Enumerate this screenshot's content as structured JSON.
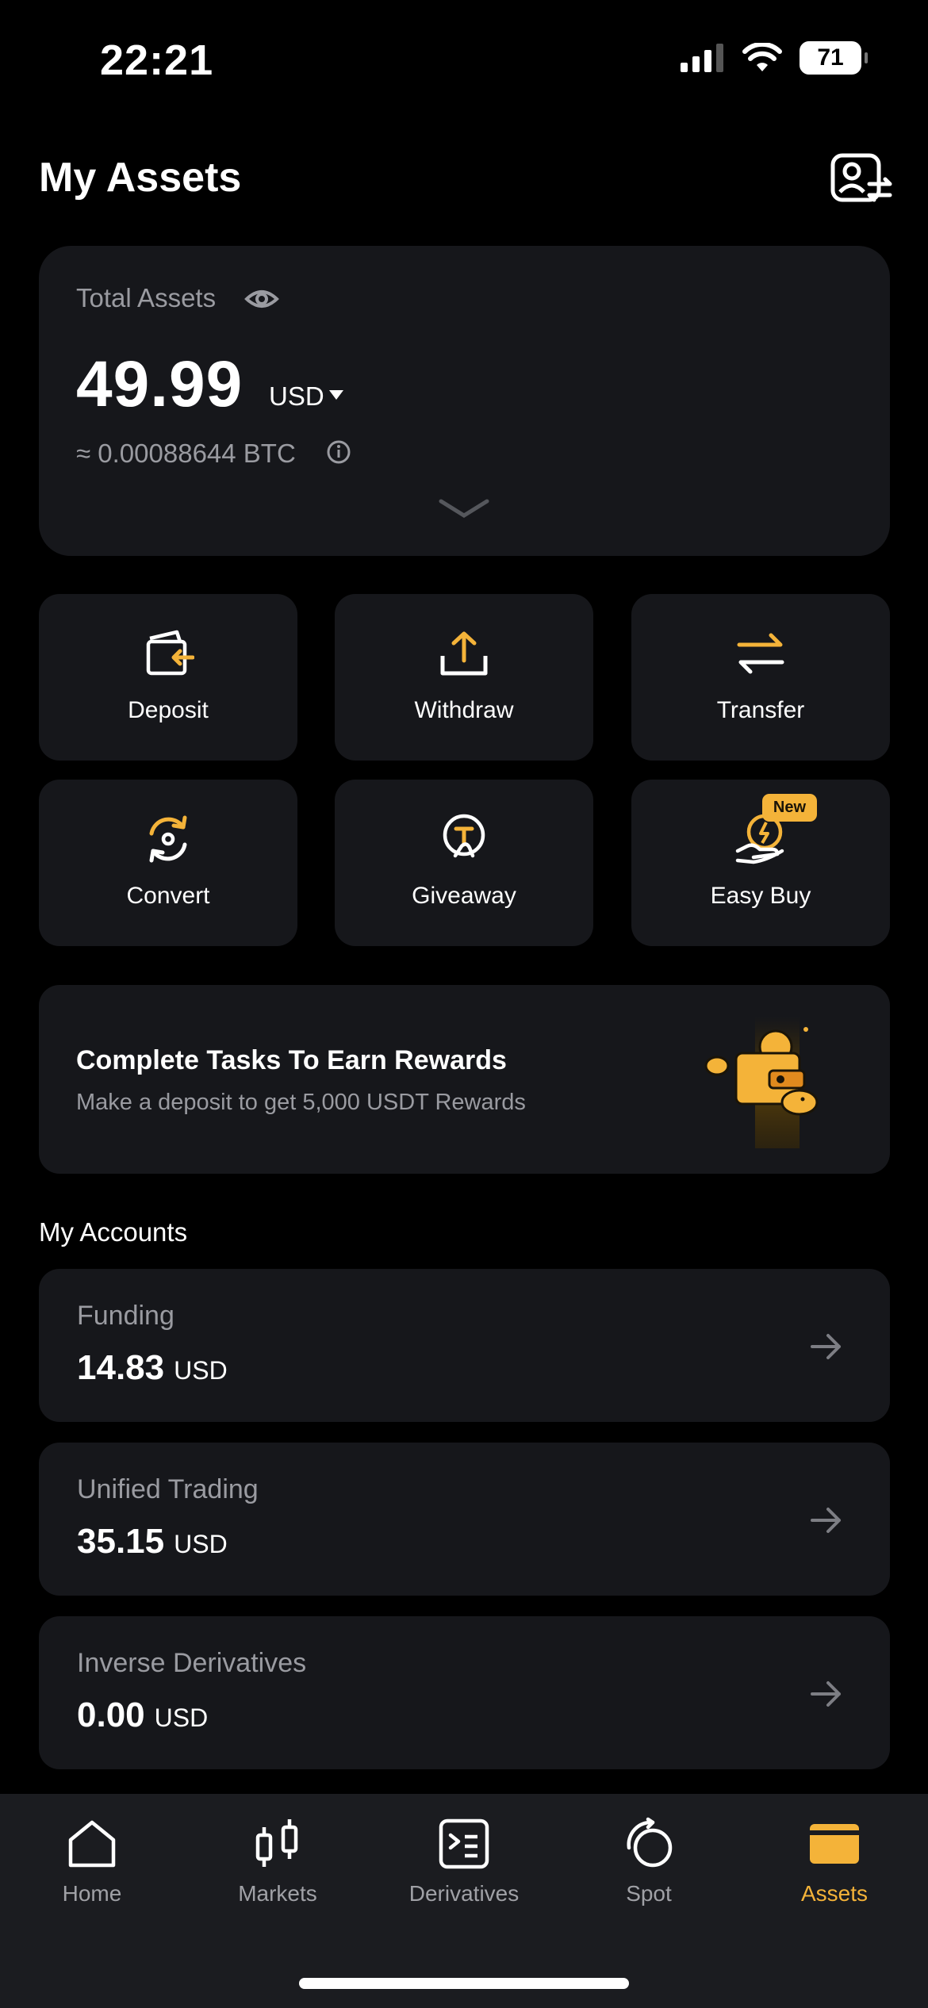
{
  "status_bar": {
    "time": "22:21",
    "battery": "71"
  },
  "header": {
    "title": "My Assets"
  },
  "total_assets": {
    "label": "Total Assets",
    "value": "49.99",
    "currency": "USD",
    "btc_equivalent": "≈ 0.00088644 BTC"
  },
  "actions": [
    {
      "label": "Deposit",
      "icon": "deposit-wallet-icon"
    },
    {
      "label": "Withdraw",
      "icon": "upload-icon"
    },
    {
      "label": "Transfer",
      "icon": "transfer-arrows-icon"
    },
    {
      "label": "Convert",
      "icon": "convert-icon"
    },
    {
      "label": "Giveaway",
      "icon": "giveaway-icon"
    },
    {
      "label": "Easy Buy",
      "icon": "easy-buy-icon",
      "badge": "New"
    }
  ],
  "banner": {
    "title": "Complete Tasks To Earn Rewards",
    "subtitle": "Make a deposit to get 5,000 USDT Rewards"
  },
  "accounts_section": {
    "title": "My Accounts",
    "items": [
      {
        "name": "Funding",
        "value": "14.83",
        "currency": "USD"
      },
      {
        "name": "Unified Trading",
        "value": "35.15",
        "currency": "USD"
      },
      {
        "name": "Inverse Derivatives",
        "value": "0.00",
        "currency": "USD"
      }
    ]
  },
  "bottom_nav": [
    {
      "label": "Home",
      "icon": "home-icon"
    },
    {
      "label": "Markets",
      "icon": "candlestick-icon"
    },
    {
      "label": "Derivatives",
      "icon": "derivatives-icon"
    },
    {
      "label": "Spot",
      "icon": "spot-icon"
    },
    {
      "label": "Assets",
      "icon": "wallet-icon",
      "active": true
    }
  ],
  "colors": {
    "accent": "#f4b339",
    "card": "#16171b",
    "background": "#000000",
    "muted": "#9a9ba1"
  }
}
